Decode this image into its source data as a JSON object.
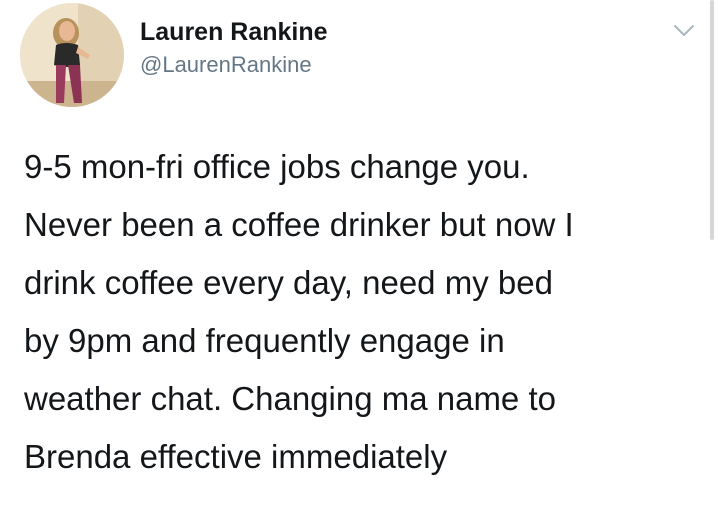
{
  "tweet": {
    "author": {
      "display_name": "Lauren Rankine",
      "handle": "@LaurenRankine",
      "avatar_icon": "profile-photo"
    },
    "menu_icon": "chevron-down-icon",
    "text_lines": [
      "9-5 mon-fri office jobs change you.",
      "Never been a coffee drinker but now I",
      "drink coffee every day, need my bed",
      "by 9pm and frequently engage in",
      "weather chat. Changing ma name to",
      "Brenda effective immediately"
    ]
  },
  "colors": {
    "text": "#14171a",
    "secondary_text": "#657786",
    "chevron": "#aab8c2",
    "background": "#ffffff"
  }
}
